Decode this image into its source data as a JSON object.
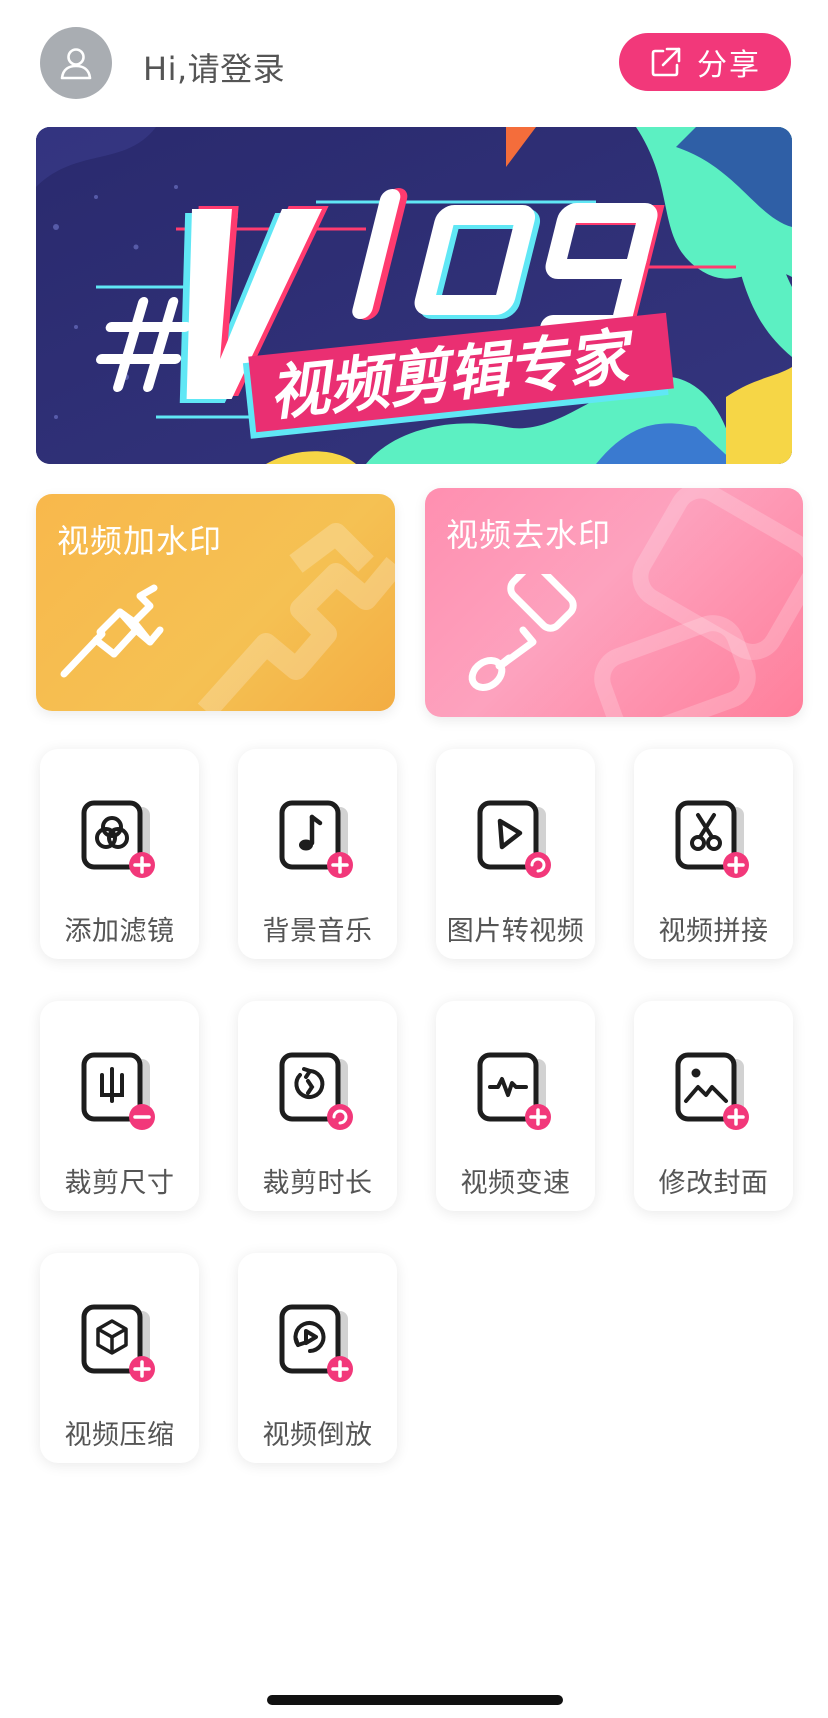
{
  "header": {
    "login_text": "Hi,请登录",
    "share_label": "分享"
  },
  "banner": {
    "headline": "Vlog",
    "subtitle": "视频剪辑专家",
    "hash": "#"
  },
  "features": [
    {
      "title": "视频加水印",
      "icon": "brush-icon"
    },
    {
      "title": "视频去水印",
      "icon": "paint-roller-icon"
    }
  ],
  "tools": [
    {
      "label": "添加滤镜",
      "icon": "filter-icon"
    },
    {
      "label": "背景音乐",
      "icon": "music-note-icon"
    },
    {
      "label": "图片转视频",
      "icon": "play-icon"
    },
    {
      "label": "视频拼接",
      "icon": "scissors-icon"
    },
    {
      "label": "裁剪尺寸",
      "icon": "crop-icon"
    },
    {
      "label": "裁剪时长",
      "icon": "timer-icon"
    },
    {
      "label": "视频变速",
      "icon": "waveform-icon"
    },
    {
      "label": "修改封面",
      "icon": "image-icon"
    },
    {
      "label": "视频压缩",
      "icon": "cube-icon"
    },
    {
      "label": "视频倒放",
      "icon": "reverse-play-icon"
    }
  ],
  "colors": {
    "accent": "#f2387a",
    "watermark_add": "#f5b84a",
    "watermark_remove": "#ff8fb0"
  }
}
